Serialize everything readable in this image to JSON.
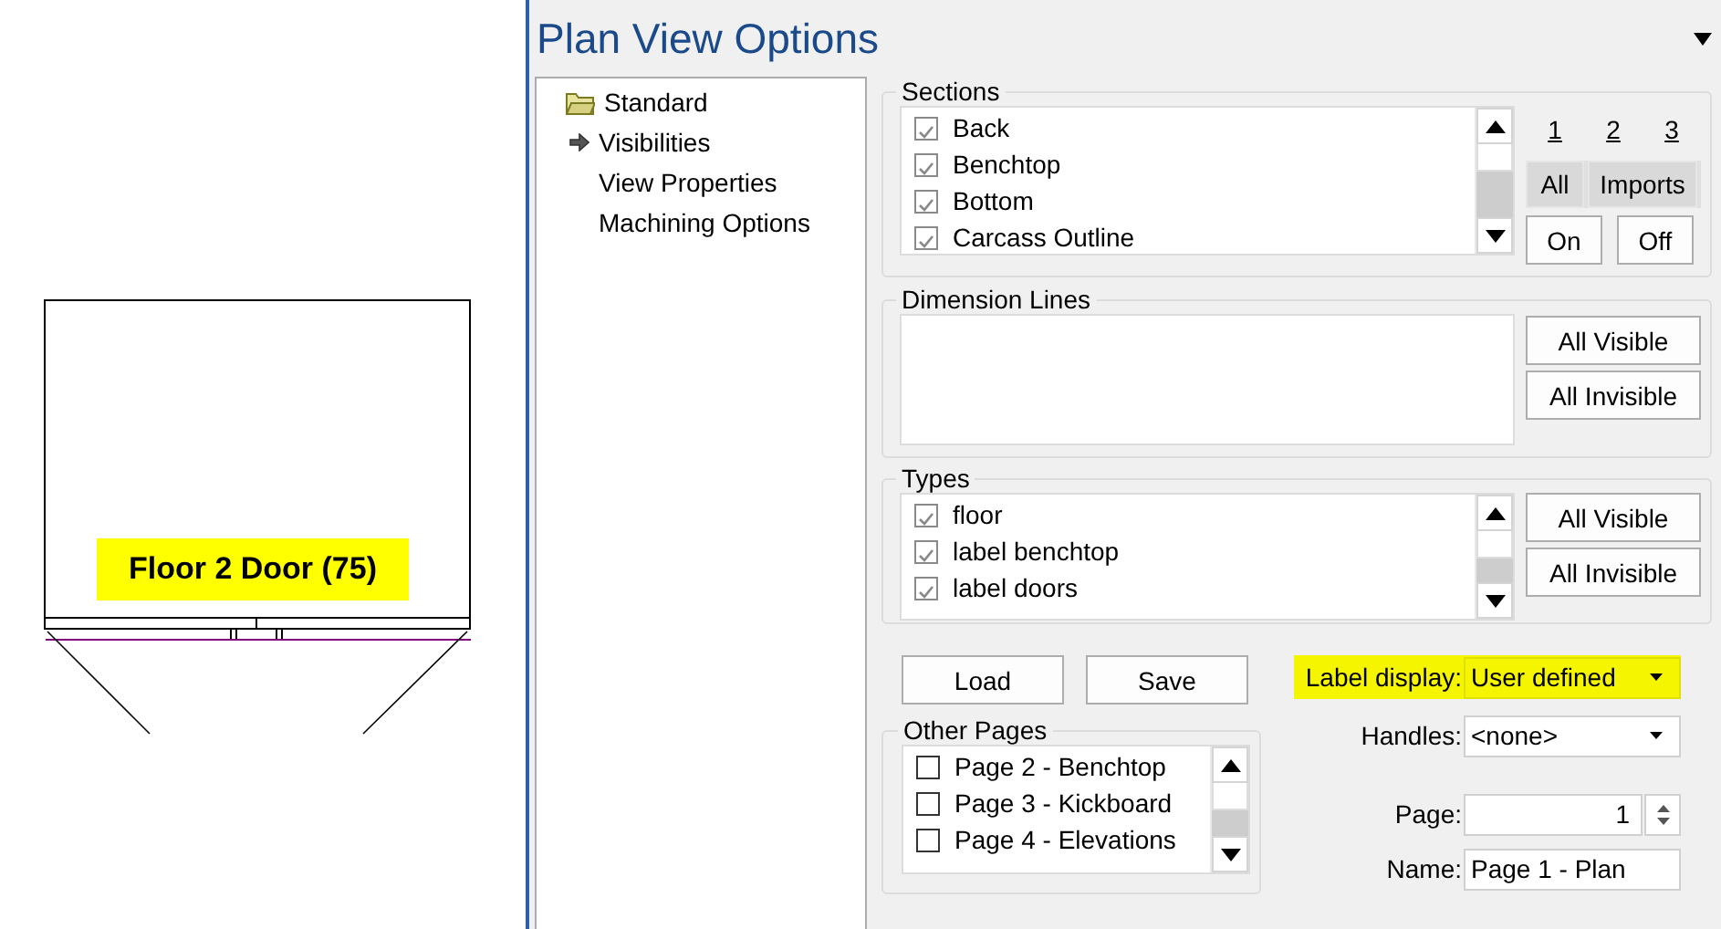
{
  "drawing": {
    "label": "Floor 2 Door (75)"
  },
  "dialog": {
    "title": "Plan View Options",
    "tree": [
      {
        "label": "Standard",
        "selected": false,
        "children": [
          {
            "label": "Visibilities",
            "selected": true
          },
          {
            "label": "View Properties",
            "selected": false
          },
          {
            "label": "Machining Options",
            "selected": false
          }
        ]
      }
    ],
    "sections": {
      "title": "Sections",
      "items": [
        {
          "label": "Back",
          "checked": true
        },
        {
          "label": "Benchtop",
          "checked": true
        },
        {
          "label": "Bottom",
          "checked": true
        },
        {
          "label": "Carcass Outline",
          "checked": true
        }
      ],
      "layer_links": [
        "1",
        "2",
        "3"
      ],
      "filter_buttons": [
        "All",
        "Imports"
      ],
      "buttons": [
        "On",
        "Off"
      ]
    },
    "dimension_lines": {
      "title": "Dimension Lines",
      "buttons": [
        "All Visible",
        "All Invisible"
      ]
    },
    "types": {
      "title": "Types",
      "items": [
        {
          "label": "floor",
          "checked": true
        },
        {
          "label": "label benchtop",
          "checked": true
        },
        {
          "label": "label doors",
          "checked": true
        }
      ],
      "buttons": [
        "All Visible",
        "All Invisible"
      ]
    },
    "actions": [
      "Load",
      "Save"
    ],
    "other_pages": {
      "title": "Other Pages",
      "items": [
        {
          "label": "Page 2 - Benchtop",
          "checked": false
        },
        {
          "label": "Page 3 - Kickboard",
          "checked": false
        },
        {
          "label": "Page 4 - Elevations",
          "checked": false
        }
      ]
    },
    "fields": [
      {
        "kind": "dropdown",
        "label": "Label display:",
        "value": "User defined",
        "highlighted": true
      },
      {
        "kind": "dropdown",
        "label": "Handles:",
        "value": "<none>",
        "highlighted": false
      },
      {
        "kind": "spin",
        "label": "Page:",
        "value": "1"
      },
      {
        "kind": "text",
        "label": "Name:",
        "value": "Page 1 - Plan"
      }
    ]
  }
}
